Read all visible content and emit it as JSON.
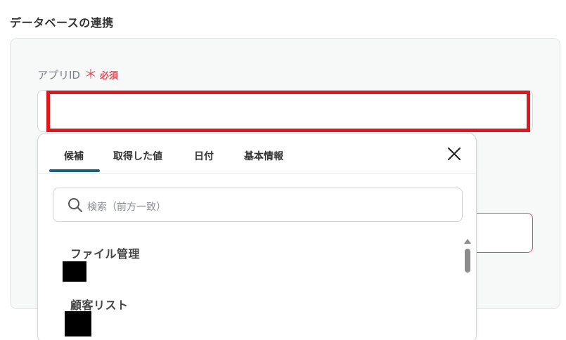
{
  "section": {
    "title": "データベースの連携"
  },
  "field": {
    "label": "アプリID",
    "required_mark": "＊",
    "required_text": "必須",
    "value": ""
  },
  "dropdown": {
    "tabs": [
      {
        "label": "候補",
        "active": true
      },
      {
        "label": "取得した値",
        "active": false
      },
      {
        "label": "日付",
        "active": false
      },
      {
        "label": "基本情報",
        "active": false
      }
    ],
    "search_placeholder": "検索（前方一致）",
    "items": [
      {
        "label": "ファイル管理"
      },
      {
        "label": "顧客リスト"
      }
    ]
  },
  "colors": {
    "accent": "#1b5f7a",
    "required": "#e24a5a",
    "highlight": "#e1171e"
  }
}
